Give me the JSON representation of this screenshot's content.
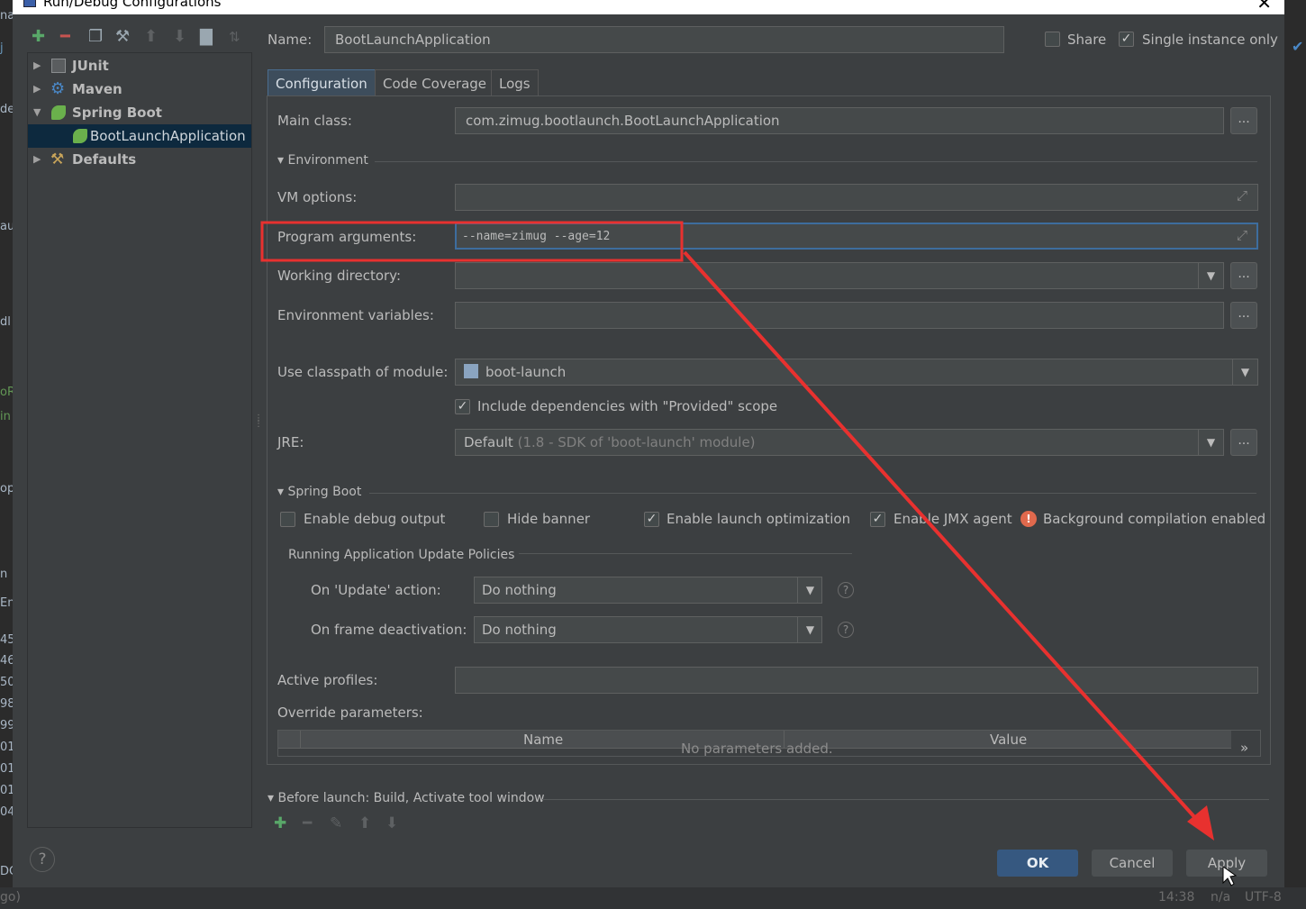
{
  "window": {
    "title": "Run/Debug Configurations"
  },
  "tree": {
    "items": [
      {
        "label": "JUnit",
        "expanded": false
      },
      {
        "label": "Maven",
        "expanded": false
      },
      {
        "label": "Spring Boot",
        "expanded": true
      },
      {
        "label": "BootLaunchApplication",
        "selected": true
      },
      {
        "label": "Defaults",
        "expanded": false
      }
    ]
  },
  "header": {
    "name_label": "Name:",
    "name_value": "BootLaunchApplication",
    "share_label": "Share",
    "share_checked": false,
    "single_instance_label": "Single instance only",
    "single_instance_checked": true
  },
  "tabs": [
    "Configuration",
    "Code Coverage",
    "Logs"
  ],
  "config": {
    "main_class_label": "Main class:",
    "main_class_value": "com.zimug.bootlaunch.BootLaunchApplication",
    "environment_header": "Environment",
    "vm_options_label": "VM options:",
    "vm_options_value": "",
    "program_args_label": "Program arguments:",
    "program_args_value": "--name=zimug --age=12",
    "working_dir_label": "Working directory:",
    "working_dir_value": "",
    "env_vars_label": "Environment variables:",
    "env_vars_value": "",
    "classpath_label": "Use classpath of module:",
    "classpath_value": "boot-launch",
    "include_deps_label": "Include dependencies with \"Provided\" scope",
    "include_deps_checked": true,
    "jre_label": "JRE:",
    "jre_value": "Default",
    "jre_hint": "(1.8 - SDK of 'boot-launch' module)"
  },
  "spring_boot": {
    "header": "Spring Boot",
    "debug_output_label": "Enable debug output",
    "debug_output_checked": false,
    "hide_banner_label": "Hide banner",
    "hide_banner_checked": false,
    "launch_opt_label": "Enable launch optimization",
    "launch_opt_checked": true,
    "jmx_label": "Enable JMX agent",
    "jmx_checked": true,
    "bg_compile_label": "Background compilation enabled",
    "policies_header": "Running Application Update Policies",
    "update_action_label": "On 'Update' action:",
    "update_action_value": "Do nothing",
    "frame_deact_label": "On frame deactivation:",
    "frame_deact_value": "Do nothing",
    "active_profiles_label": "Active profiles:",
    "active_profiles_value": "",
    "override_label": "Override parameters:",
    "table_headers": [
      "Name",
      "Value"
    ],
    "table_empty": "No parameters added."
  },
  "before_launch": {
    "label": "Before launch: Build, Activate tool window"
  },
  "footer": {
    "ok": "OK",
    "cancel": "Cancel",
    "apply": "Apply"
  },
  "statusbar": {
    "time": "14:38",
    "na": "n/a",
    "encoding": "UTF-8"
  },
  "backdrop": {
    "left_fragments": [
      "na",
      "j",
      "de",
      "au",
      "dl",
      "oR",
      "in",
      "op",
      "n",
      "En",
      "45",
      "46",
      "50",
      "98",
      "99",
      "01",
      "01",
      "01",
      "04",
      "DC",
      "go)"
    ]
  },
  "colors": {
    "accent": "#365880",
    "annotation": "#e8312f",
    "selection": "#0d293e"
  }
}
